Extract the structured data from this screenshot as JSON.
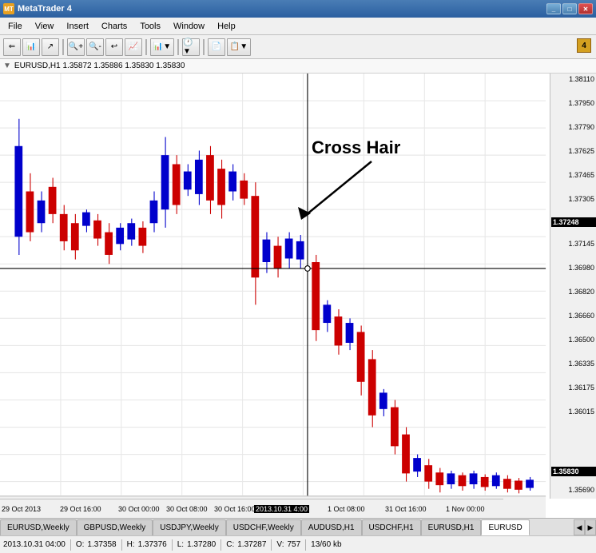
{
  "window": {
    "title": "MetaTrader 4",
    "icon": "MT"
  },
  "titlebar": {
    "controls": [
      "_",
      "□",
      "✕"
    ]
  },
  "menu": {
    "items": [
      "File",
      "View",
      "Insert",
      "Charts",
      "Tools",
      "Window",
      "Help"
    ]
  },
  "toolbar": {
    "badge": "4"
  },
  "chart": {
    "header": "EURUSD,H1  1.35872  1.35886  1.35830  1.35830",
    "crosshair_label": "Cross Hair",
    "price_levels": [
      "1.38110",
      "1.37950",
      "1.37790",
      "1.37625",
      "1.37465",
      "1.37305",
      "1.37248",
      "1.37145",
      "1.36980",
      "1.36820",
      "1.36660",
      "1.36500",
      "1.36335",
      "1.36175",
      "1.36015",
      "1.35830",
      "1.35690"
    ],
    "time_labels": [
      "29 Oct 2013",
      "29 Oct 16:00",
      "30 Oct 00:00",
      "30 Oct 08:00",
      "30 Oct 16:00",
      "2013.10.31 4:00",
      "1 Oct 08:00",
      "31 Oct 16:00",
      "1 Nov 00:00"
    ]
  },
  "tabs": {
    "items": [
      {
        "label": "EURUSD,Weekly",
        "active": false
      },
      {
        "label": "GBPUSD,Weekly",
        "active": false
      },
      {
        "label": "USDJPY,Weekly",
        "active": false
      },
      {
        "label": "USDCHF,Weekly",
        "active": false
      },
      {
        "label": "AUDUSD,H1",
        "active": false
      },
      {
        "label": "USDCHF,H1",
        "active": false
      },
      {
        "label": "EURUSD,H1",
        "active": false
      },
      {
        "label": "EURUSD",
        "active": true
      }
    ]
  },
  "statusbar": {
    "datetime": "2013.10.31 04:00",
    "open_label": "O:",
    "open_value": "1.37358",
    "high_label": "H:",
    "high_value": "1.37376",
    "low_label": "L:",
    "low_value": "1.37280",
    "close_label": "C:",
    "close_value": "1.37287",
    "volume_label": "V:",
    "volume_value": "757",
    "size_info": "13/60 kb"
  }
}
